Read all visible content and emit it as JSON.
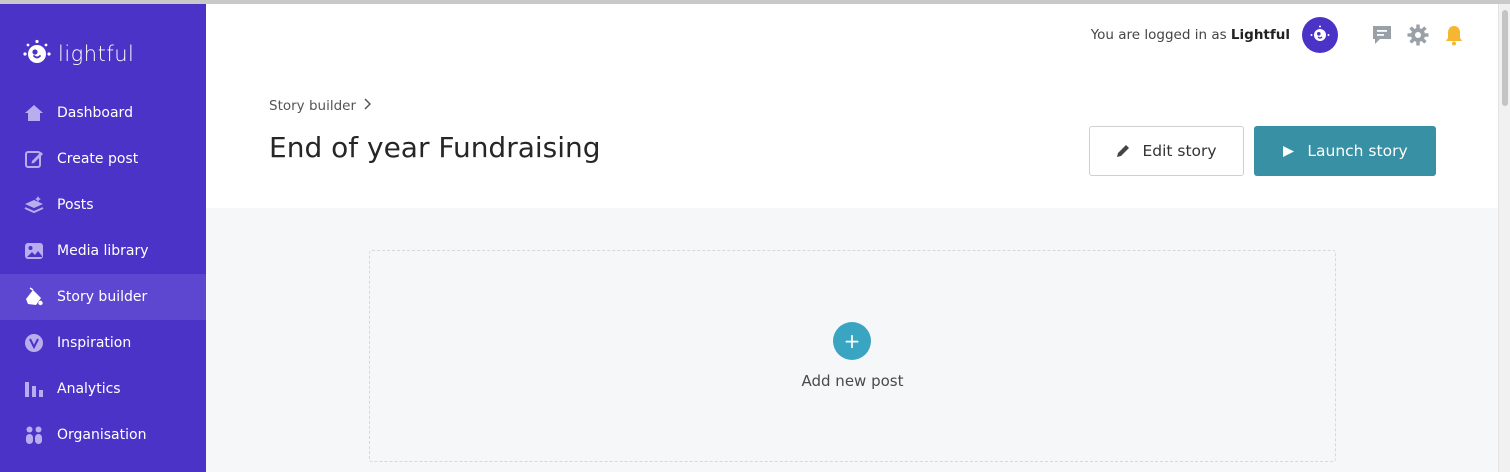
{
  "brand": {
    "name": "lightful"
  },
  "sidebar": {
    "items": [
      {
        "label": "Dashboard",
        "icon": "home-icon",
        "active": false
      },
      {
        "label": "Create post",
        "icon": "edit-icon",
        "active": false
      },
      {
        "label": "Posts",
        "icon": "layers-icon",
        "active": false
      },
      {
        "label": "Media library",
        "icon": "image-icon",
        "active": false
      },
      {
        "label": "Story builder",
        "icon": "story-icon",
        "active": true
      },
      {
        "label": "Inspiration",
        "icon": "inspiration-icon",
        "active": false
      },
      {
        "label": "Analytics",
        "icon": "bar-chart-icon",
        "active": false
      },
      {
        "label": "Organisation",
        "icon": "people-icon",
        "active": false
      }
    ]
  },
  "header": {
    "logged_in_prefix": "You are logged in as",
    "user_name": "Lightful"
  },
  "breadcrumb": {
    "label": "Story builder"
  },
  "page": {
    "title": "End of year Fundraising"
  },
  "actions": {
    "edit_label": "Edit story",
    "launch_label": "Launch story"
  },
  "content": {
    "add_icon": "+",
    "add_label": "Add new post"
  },
  "colors": {
    "sidebar": "#4b33c8",
    "sidebar_active": "#5e47d0",
    "launch_button": "#3790a3",
    "add_button": "#3aa5c3",
    "bell": "#f5b731"
  }
}
